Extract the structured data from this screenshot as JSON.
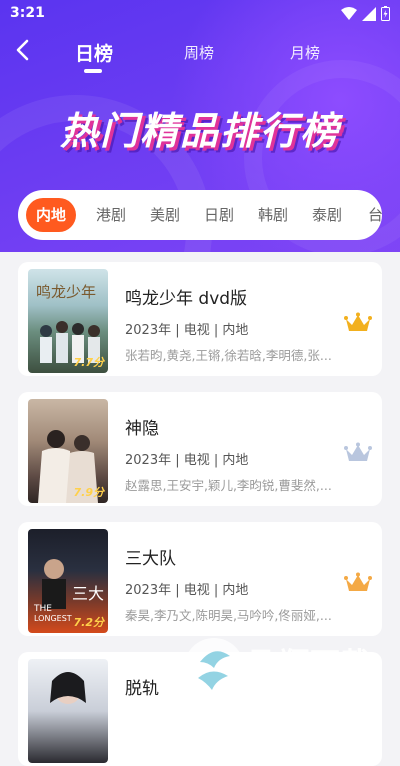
{
  "status_bar": {
    "time": "3:21"
  },
  "nav": {
    "tabs": [
      {
        "label": "日榜",
        "active": true
      },
      {
        "label": "周榜",
        "active": false
      },
      {
        "label": "月榜",
        "active": false
      }
    ]
  },
  "banner": {
    "title": "热门精品排行榜"
  },
  "categories": [
    "内地",
    "港剧",
    "美剧",
    "日剧",
    "韩剧",
    "泰剧",
    "台"
  ],
  "colors": {
    "accent": "#ff5a1f",
    "gold_crown": "#f2b01e",
    "silver_crown": "#b9c6de",
    "bronze_crown": "#f4a945",
    "score": "#ffd04a"
  },
  "rankings": [
    {
      "title": "鸣龙少年 dvd版",
      "meta": "2023年 | 电视 | 内地",
      "cast": "张若昀,黄尧,王锵,徐若晗,李明德,张...",
      "score": "7.7分",
      "crown": "gold"
    },
    {
      "title": "神隐",
      "meta": "2023年 | 电视 | 内地",
      "cast": "赵露思,王安宇,颖儿,李昀锐,曹斐然,...",
      "score": "7.9分",
      "crown": "silver"
    },
    {
      "title": "三大队",
      "meta": "2023年 | 电视 | 内地",
      "cast": "秦昊,李乃文,陈明昊,马吟吟,佟丽娅,...",
      "score": "7.2分",
      "crown": "bronze"
    },
    {
      "title": "脱轨",
      "meta": "",
      "cast": "",
      "score": "",
      "crown": ""
    }
  ],
  "watermark": {
    "text": "飞翔下载",
    "url": "WWW.FXXZ.COM"
  }
}
